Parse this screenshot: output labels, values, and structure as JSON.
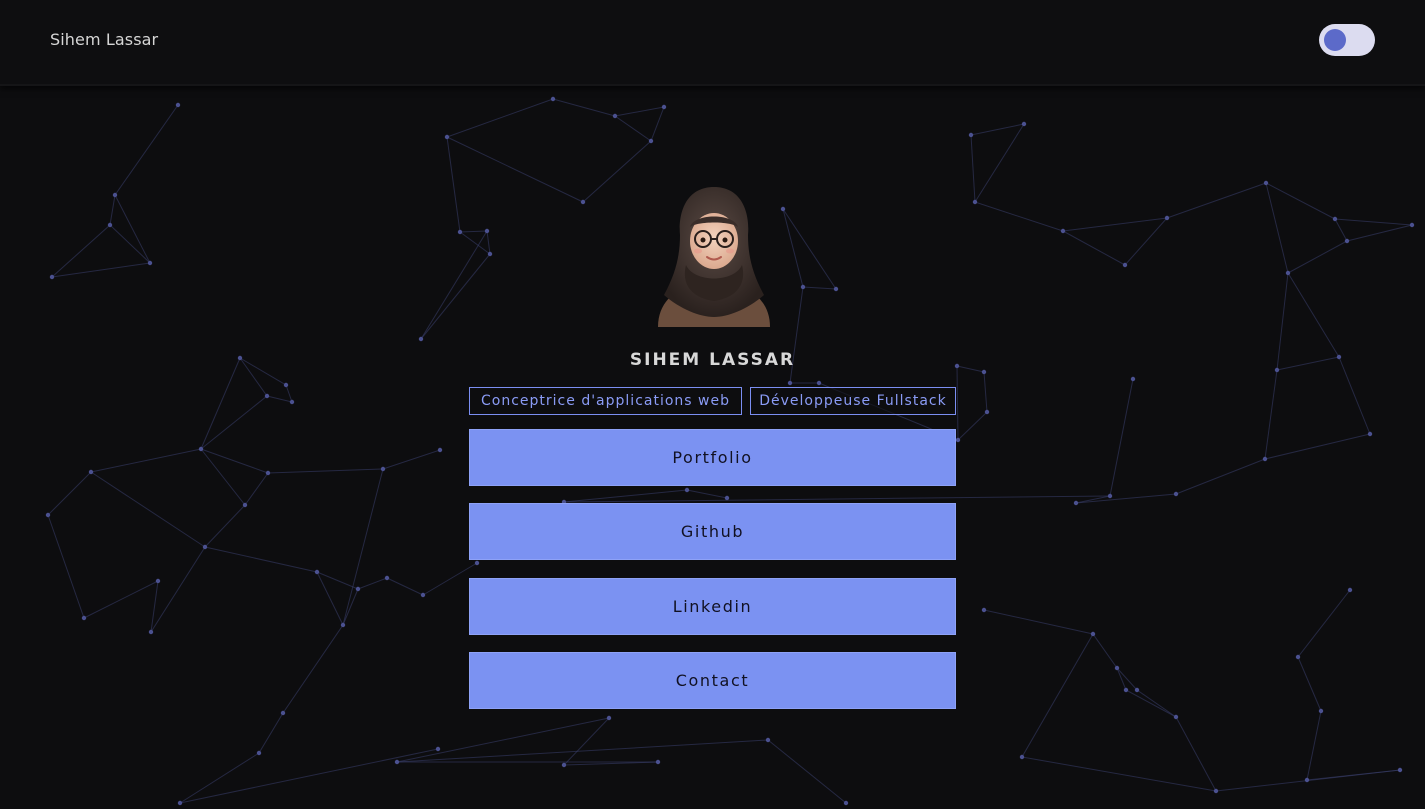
{
  "header": {
    "brand": "Sihem Lassar",
    "theme_toggle": "dark-mode-toggle"
  },
  "profile": {
    "avatar": "avatar-illustration",
    "name": "SIHEM LASSAR",
    "tags": [
      "Conceptrice d'applications web",
      "Développeuse Fullstack"
    ]
  },
  "links": {
    "items": [
      "Portfolio",
      "Github",
      "Linkedin",
      "Contact"
    ]
  },
  "colors": {
    "background": "#0d0d0f",
    "accent": "#7b92f2",
    "tag_border": "#7b8ef2",
    "network": "#3a3f6e"
  }
}
